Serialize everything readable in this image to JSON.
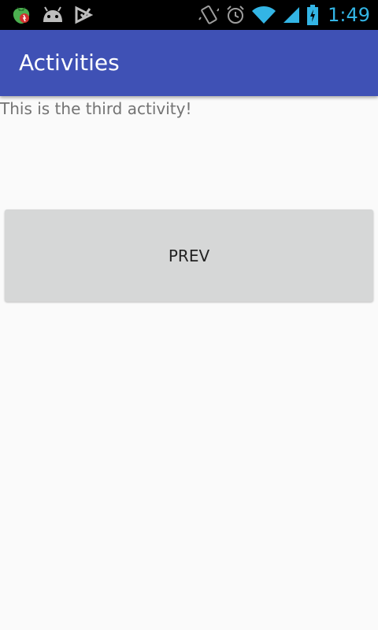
{
  "status_bar": {
    "time": "1:49",
    "left_icons": [
      "strawberry-app-icon",
      "android-debug-icon",
      "download-check-icon"
    ],
    "right_icons": [
      "vibrate-icon",
      "alarm-icon",
      "wifi-icon",
      "signal-icon",
      "battery-charging-icon"
    ],
    "time_color": "#33b5e5"
  },
  "app_bar": {
    "title": "Activities",
    "color": "#3f51b5"
  },
  "content": {
    "message": "This is the third activity!",
    "prev_button_label": "PREV",
    "button_color": "#d6d7d7"
  }
}
